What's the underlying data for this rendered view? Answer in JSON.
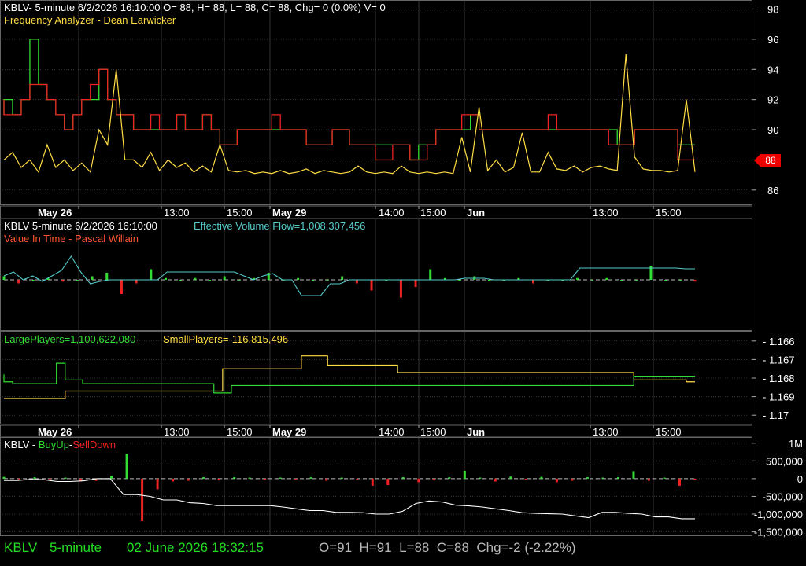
{
  "colors": {
    "background": "#000000",
    "grid": "#555555",
    "frame": "#666666",
    "text": "#ffffff",
    "green": "#33dd33",
    "red": "#ee2222",
    "yellow": "#ffdd44",
    "orange": "#ff8844",
    "cyan": "#55cccc",
    "footer_green": "#22dd22",
    "footer_gray": "#b8b8b8",
    "white_line": "#ffffff",
    "price_tag": "#ee0000"
  },
  "time_axis": {
    "labels": [
      "May 26",
      "13:00",
      "15:00",
      "May 29",
      "14:00",
      "15:00",
      "Jun",
      "13:00",
      "15:00"
    ],
    "bold": [
      true,
      false,
      false,
      true,
      false,
      false,
      true,
      false,
      false
    ]
  },
  "panel1": {
    "header": "KBLV- 5-minute 6/2/2026 16:10:00 O= 88, H= 88, L= 88, C= 88, Chg= 0 (0.0%) V= 0",
    "indicator": "Frequency Analyzer - Dean Earwicker",
    "price_tag": "88"
  },
  "panel2": {
    "header_prefix": "KBLV 5-minute  6/2/2026 16:10:00",
    "header_flow": "Effective Volume Flow=1,008,307,456",
    "indicator": "Value In Time - Pascal Willain"
  },
  "panel3": {
    "large_label": "LargePlayers=1,100,622,080",
    "small_label": "SmallPlayers=-116,815,496"
  },
  "panel4": {
    "prefix": "KBLV - ",
    "buy": "BuyUp",
    "dash": "-",
    "sell": "SellDown"
  },
  "footer": {
    "symbol": "KBLV",
    "interval": "5-minute",
    "datetime": "02 June 2026 18:32:15",
    "ohlc": "O=91  H=91  L=88  C=88  Chg=-2 (-2.22%)"
  },
  "chart_data": [
    {
      "panel": "price",
      "type": "line",
      "y_ticks": [
        98,
        96,
        94,
        92,
        90,
        88,
        86
      ],
      "ylim": [
        85,
        98.6
      ],
      "grid": true,
      "series": [
        {
          "color": "red",
          "values": [
            92,
            91,
            91,
            92,
            93,
            93,
            92,
            91,
            90,
            91,
            92,
            93,
            94,
            92,
            91,
            91,
            90,
            90,
            91,
            90,
            90,
            91,
            90,
            90,
            91,
            90,
            89,
            89,
            90,
            90,
            90,
            90,
            91,
            90,
            90,
            90,
            89,
            89,
            89,
            90,
            90,
            89,
            89,
            89,
            88,
            88,
            89,
            89,
            88,
            88,
            89,
            90,
            90,
            90,
            91,
            91,
            90,
            90,
            90,
            90,
            90,
            90,
            90,
            90,
            91,
            90,
            90,
            90,
            90,
            90,
            90,
            89,
            89,
            89,
            90,
            90,
            90,
            90,
            90,
            88,
            88
          ],
          "values_green": [
            91,
            92,
            91,
            92,
            96,
            93,
            92,
            91,
            90,
            91,
            92,
            92,
            94,
            92,
            91,
            91,
            90,
            90,
            90,
            90,
            90,
            91,
            90,
            90,
            91,
            90,
            89,
            89,
            90,
            90,
            90,
            90,
            90,
            90,
            90,
            90,
            89,
            89,
            89,
            90,
            90,
            89,
            89,
            89,
            89,
            89,
            89,
            89,
            88,
            89,
            89,
            90,
            90,
            90,
            90,
            91,
            90,
            90,
            90,
            90,
            90,
            90,
            90,
            90,
            90,
            90,
            90,
            90,
            90,
            90,
            90,
            90,
            89,
            89,
            90,
            90,
            90,
            90,
            90,
            89,
            89
          ]
        },
        {
          "color": "yellow",
          "values": [
            88,
            88.5,
            87.5,
            88,
            87.2,
            89,
            87.5,
            88,
            87.3,
            87.8,
            87.2,
            90,
            89,
            94,
            88,
            88,
            87.5,
            88.5,
            87.3,
            88,
            87.5,
            87.8,
            87.2,
            87.6,
            87.2,
            89,
            87.3,
            87.2,
            87.3,
            87.1,
            87.2,
            87.1,
            87.3,
            87.1,
            87.2,
            87.4,
            87.1,
            87.3,
            87.2,
            87.1,
            87.2,
            87.6,
            87.2,
            87.1,
            87.2,
            87.1,
            87.6,
            87.2,
            87.1,
            87.2,
            87.1,
            87.2,
            87.1,
            89.5,
            87.2,
            91.5,
            87.3,
            88,
            87.2,
            87.5,
            89.8,
            87.2,
            87.2,
            88.5,
            87.4,
            87.3,
            87.6,
            87.2,
            87.5,
            87.6,
            87.4,
            87.3,
            95,
            88.2,
            87.4,
            87.3,
            87.3,
            87.2,
            87.3,
            92,
            87.2
          ]
        }
      ]
    },
    {
      "panel": "value_in_time",
      "type": "line",
      "series": [
        {
          "name": "Effective Volume Flow",
          "color": "cyan",
          "values": [
            0.05,
            0.1,
            0.0,
            0.05,
            -0.02,
            0.05,
            0.12,
            0.3,
            0.1,
            -0.05,
            -0.02,
            0.0,
            0.0,
            0.0,
            0.0,
            0.0,
            0.0,
            0.1,
            0.1,
            0.1,
            0.1,
            0.1,
            0.1,
            0.1,
            0.1,
            0.05,
            0.0,
            0.05,
            0.08,
            0.0,
            0.0,
            -0.2,
            -0.2,
            -0.2,
            -0.05,
            -0.05,
            0.0,
            0.0,
            0.0,
            0.0,
            0.0,
            0.0,
            0.0,
            0.0,
            0.0,
            0.0,
            0.0,
            0.0,
            0.02,
            0.02,
            0.02,
            0.0,
            0.0,
            0.0,
            0.0,
            0.0,
            0.0,
            0.0,
            0.0,
            0.0,
            0.15,
            0.15,
            0.15,
            0.15,
            0.15,
            0.15,
            0.15,
            0.15,
            0.15,
            0.15,
            0.15,
            0.14,
            0.14
          ]
        }
      ],
      "bars": [
        0.1,
        -0.1,
        0.0,
        0.05,
        -0.05,
        0.0,
        0.1,
        0.2,
        -0.4,
        -0.1,
        0.3,
        0.05,
        0.0,
        0.05,
        0.0,
        0.1,
        0.0,
        0.05,
        0.2,
        0.0,
        0.05,
        0.0,
        0.0,
        0.1,
        -0.1,
        -0.3,
        0.0,
        -0.5,
        -0.2,
        0.3,
        0.05,
        0.0,
        0.1,
        0.0,
        0.0,
        0.05,
        -0.1,
        0.0,
        0.0,
        0.05,
        0.0,
        0.05,
        0.0,
        0.0,
        0.4,
        0.0,
        0.0,
        -0.05
      ]
    },
    {
      "panel": "players",
      "type": "line",
      "y_ticks": [
        -1.166,
        -1.167,
        -1.168,
        -1.169,
        -1.17
      ],
      "ylim": [
        -1.1705,
        -1.1655
      ],
      "series": [
        {
          "name": "LargePlayers",
          "color": "green",
          "values": [
            -1.1678,
            -1.1682,
            -1.1683,
            -1.1683,
            -1.1683,
            -1.1683,
            -1.1683,
            -1.1672,
            -1.1681,
            -1.1681,
            -1.1683,
            -1.1683,
            -1.1683,
            -1.1683,
            -1.1683,
            -1.1683,
            -1.1683,
            -1.1683,
            -1.1683,
            -1.1683,
            -1.1683,
            -1.1683,
            -1.1683,
            -1.1683,
            -1.1683,
            -1.1688,
            -1.1688,
            -1.1684,
            -1.1684,
            -1.1684,
            -1.1684,
            -1.1684,
            -1.1684,
            -1.1684,
            -1.1684,
            -1.1684,
            -1.1684,
            -1.1684,
            -1.1684,
            -1.1684,
            -1.1684,
            -1.1684,
            -1.1684,
            -1.1684,
            -1.1684,
            -1.1684,
            -1.1684,
            -1.1684,
            -1.1684,
            -1.1684,
            -1.1684,
            -1.1684,
            -1.1684,
            -1.1684,
            -1.1684,
            -1.1684,
            -1.1684,
            -1.1684,
            -1.1684,
            -1.1684,
            -1.1684,
            -1.1684,
            -1.1684,
            -1.1684,
            -1.1684,
            -1.1684,
            -1.1684,
            -1.1684,
            -1.1684,
            -1.1684,
            -1.1684,
            -1.1684,
            -1.1684,
            -1.1679,
            -1.1679,
            -1.1679,
            -1.1679,
            -1.1679,
            -1.1679,
            -1.1679
          ]
        },
        {
          "name": "SmallPlayers",
          "color": "yellow",
          "values": [
            -1.1691,
            -1.1691,
            -1.1691,
            -1.1691,
            -1.1691,
            -1.1691,
            -1.1691,
            -1.1691,
            -1.1687,
            -1.1687,
            -1.1687,
            -1.1687,
            -1.1687,
            -1.1687,
            -1.1687,
            -1.1687,
            -1.1687,
            -1.1687,
            -1.1687,
            -1.1687,
            -1.1687,
            -1.1687,
            -1.1687,
            -1.1687,
            -1.1687,
            -1.1687,
            -1.1675,
            -1.1675,
            -1.1675,
            -1.1675,
            -1.1675,
            -1.1675,
            -1.1675,
            -1.1675,
            -1.1675,
            -1.1668,
            -1.1668,
            -1.1668,
            -1.1673,
            -1.1673,
            -1.1673,
            -1.1673,
            -1.1673,
            -1.1673,
            -1.1673,
            -1.1673,
            -1.1677,
            -1.1677,
            -1.1677,
            -1.1677,
            -1.1677,
            -1.1677,
            -1.1677,
            -1.1677,
            -1.1677,
            -1.1677,
            -1.1677,
            -1.1677,
            -1.1677,
            -1.1677,
            -1.1677,
            -1.1677,
            -1.1677,
            -1.1677,
            -1.1677,
            -1.1677,
            -1.1677,
            -1.1677,
            -1.1677,
            -1.1677,
            -1.1677,
            -1.1677,
            -1.1677,
            -1.1681,
            -1.1681,
            -1.1681,
            -1.1681,
            -1.1681,
            -1.1681,
            -1.1682
          ]
        }
      ]
    },
    {
      "panel": "buyup_selldown",
      "type": "bar",
      "y_ticks": [
        1000000,
        500000,
        0,
        -500000,
        -1000000,
        -1500000
      ],
      "y_tick_labels": [
        "1M",
        "500,000",
        "0",
        "-500,000",
        "-1,000,000",
        "-1,500,000"
      ],
      "ylim": [
        -1620000,
        1150000
      ],
      "bars": [
        50000,
        -30000,
        40000,
        -20000,
        30000,
        -80000,
        -60000,
        80000,
        700000,
        -1200000,
        -300000,
        -80000,
        -60000,
        40000,
        -50000,
        40000,
        30000,
        -40000,
        30000,
        -30000,
        40000,
        -60000,
        30000,
        -40000,
        -200000,
        -180000,
        40000,
        -100000,
        -50000,
        40000,
        220000,
        30000,
        -80000,
        60000,
        -30000,
        50000,
        -100000,
        -60000,
        40000,
        30000,
        40000,
        210000,
        -60000,
        30000,
        -200000,
        -30000
      ],
      "series": [
        {
          "name": "cumulative",
          "color": "white",
          "values": [
            -50000,
            -50000,
            -20000,
            -30000,
            -80000,
            -80000,
            -60000,
            0,
            0,
            -450000,
            -450000,
            -500000,
            -600000,
            -600000,
            -680000,
            -700000,
            -760000,
            -760000,
            -760000,
            -760000,
            -760000,
            -800000,
            -850000,
            -900000,
            -900000,
            -950000,
            -950000,
            -960000,
            -1000000,
            -1000000,
            -920000,
            -700000,
            -630000,
            -660000,
            -750000,
            -770000,
            -800000,
            -850000,
            -900000,
            -960000,
            -980000,
            -990000,
            -1000000,
            -1050000,
            -1100000,
            -950000,
            -950000,
            -980000,
            -1000000,
            -1080000,
            -1080000,
            -1130000,
            -1130000
          ]
        }
      ]
    }
  ]
}
